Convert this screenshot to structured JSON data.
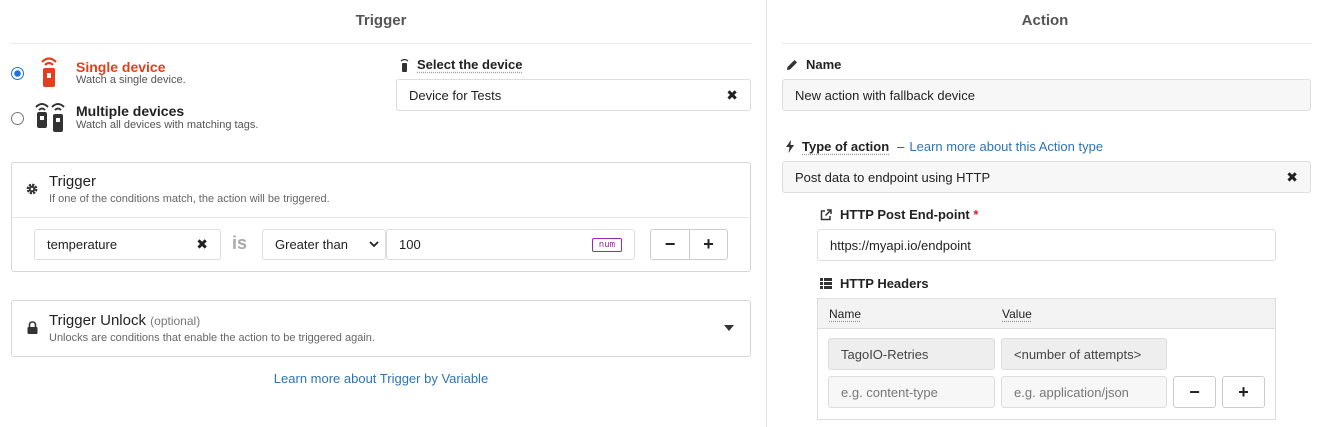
{
  "trigger": {
    "title": "Trigger",
    "single_label": "Single device",
    "single_desc": "Watch a single device.",
    "multiple_label": "Multiple devices",
    "multiple_desc": "Watch all devices with matching tags.",
    "select_device_label": "Select the device",
    "device_value": "Device for Tests",
    "section_title": "Trigger",
    "section_desc": "If one of the conditions match, the action will be triggered.",
    "variable_value": "temperature",
    "is_label": "is",
    "condition_value": "Greater than",
    "value_input": "100",
    "value_type": "num",
    "unlock_title": "Trigger Unlock",
    "unlock_optional": "(optional)",
    "unlock_desc": "Unlocks are conditions that enable the action to be triggered again.",
    "learn_more": "Learn more about Trigger by Variable",
    "accent_color": "#e0401c"
  },
  "action": {
    "title": "Action",
    "name_label": "Name",
    "name_value": "New action with fallback device",
    "type_label": "Type of action",
    "type_dash": "–",
    "type_link": "Learn more about this Action type",
    "type_value": "Post data to endpoint using HTTP",
    "endpoint_label": "HTTP Post End-point",
    "required_mark": "*",
    "endpoint_value": "https://myapi.io/endpoint",
    "headers_label": "HTTP Headers",
    "headers_col_name": "Name",
    "headers_col_value": "Value",
    "header_row_name": "TagoIO-Retries",
    "header_row_value": "<number of attempts>",
    "new_name_placeholder": "e.g. content-type",
    "new_value_placeholder": "e.g. application/json"
  }
}
